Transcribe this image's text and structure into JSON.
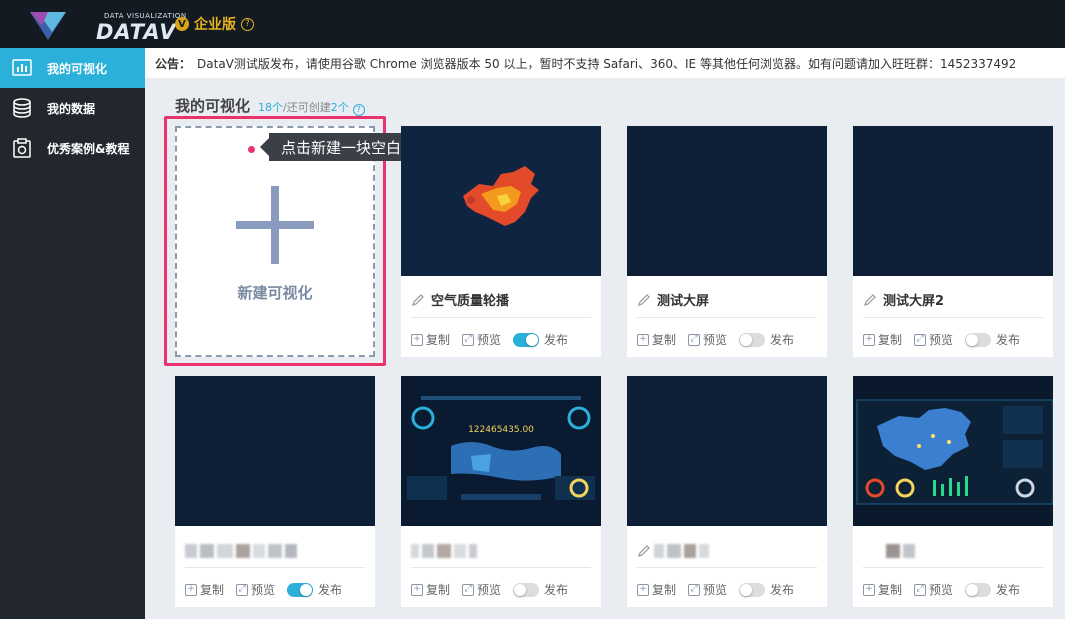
{
  "brand": {
    "sub": "DATA VISUALIZATION",
    "name": "DATAV",
    "edition": "企业版",
    "edition_badge": "V"
  },
  "sidebar": {
    "items": [
      {
        "label": "我的可视化",
        "icon": "chart-window-icon",
        "active": true
      },
      {
        "label": "我的数据",
        "icon": "database-icon",
        "active": false
      },
      {
        "label": "优秀案例&教程",
        "icon": "clipboard-camera-icon",
        "active": false
      }
    ]
  },
  "notice": {
    "prefix": "公告：",
    "text": "DataV测试版发布，请使用谷歌 Chrome 浏览器版本 50 以上，暂时不支持 Safari、360、IE 等其他任何浏览器。如有问题请加入旺旺群：1452337492"
  },
  "section": {
    "title": "我的可视化",
    "count": "18个",
    "remaining_label": "/还可创建",
    "remaining": "2个"
  },
  "new_card": {
    "label": "新建可视化",
    "tooltip": "点击新建一块空白可视化大屏"
  },
  "actions": {
    "copy": "复制",
    "preview": "预览",
    "publish": "发布"
  },
  "cards": [
    {
      "title": "空气质量轮播",
      "published": true,
      "thumb": "china-map"
    },
    {
      "title": "测试大屏",
      "published": false,
      "thumb": "blank"
    },
    {
      "title": "测试大屏2",
      "published": false,
      "thumb": "blank"
    },
    {
      "title": "",
      "published": true,
      "thumb": "blank"
    },
    {
      "title": "",
      "published": false,
      "thumb": "world-dashboard",
      "overlay_number": "122465435.00"
    },
    {
      "title": "",
      "published": false,
      "thumb": "blank"
    },
    {
      "title": "",
      "published": false,
      "thumb": "china-dashboard"
    }
  ],
  "colors": {
    "accent": "#2ab0d9",
    "highlight": "#e8336d",
    "gold": "#e6b31e",
    "topbar": "#141a21",
    "sidebar": "#22272e"
  }
}
